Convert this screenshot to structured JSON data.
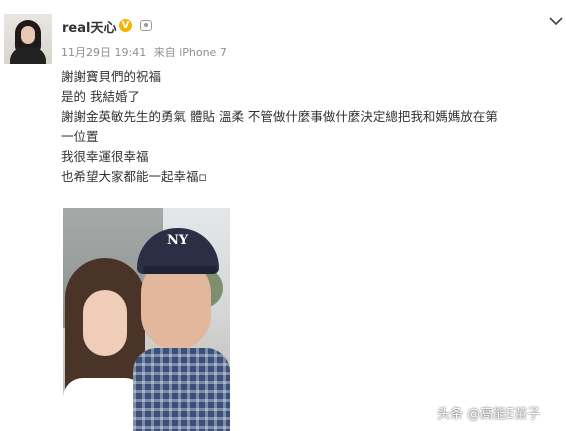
{
  "post": {
    "username": "real天心",
    "verified_badge_icon": "v-badge-icon",
    "member_icon": "member-icon",
    "timestamp": "11月29日 19:41",
    "source": "来自 iPhone 7",
    "content_lines": [
      "謝謝寶貝們的祝福",
      "是的 我結婚了",
      "謝謝金英敏先生的勇氣 體貼 溫柔 不管做什麼事做什麼決定總把我和媽媽放在第",
      "一位置",
      "我很幸運很幸福",
      "也希望大家都能一起幸福▫"
    ],
    "photo": {
      "cap_logo": "NY"
    }
  },
  "watermark": "头条 @高能E苗子",
  "colors": {
    "badge": "#f5b400",
    "meta_text": "#8f8f8f",
    "body_text": "#333333"
  }
}
